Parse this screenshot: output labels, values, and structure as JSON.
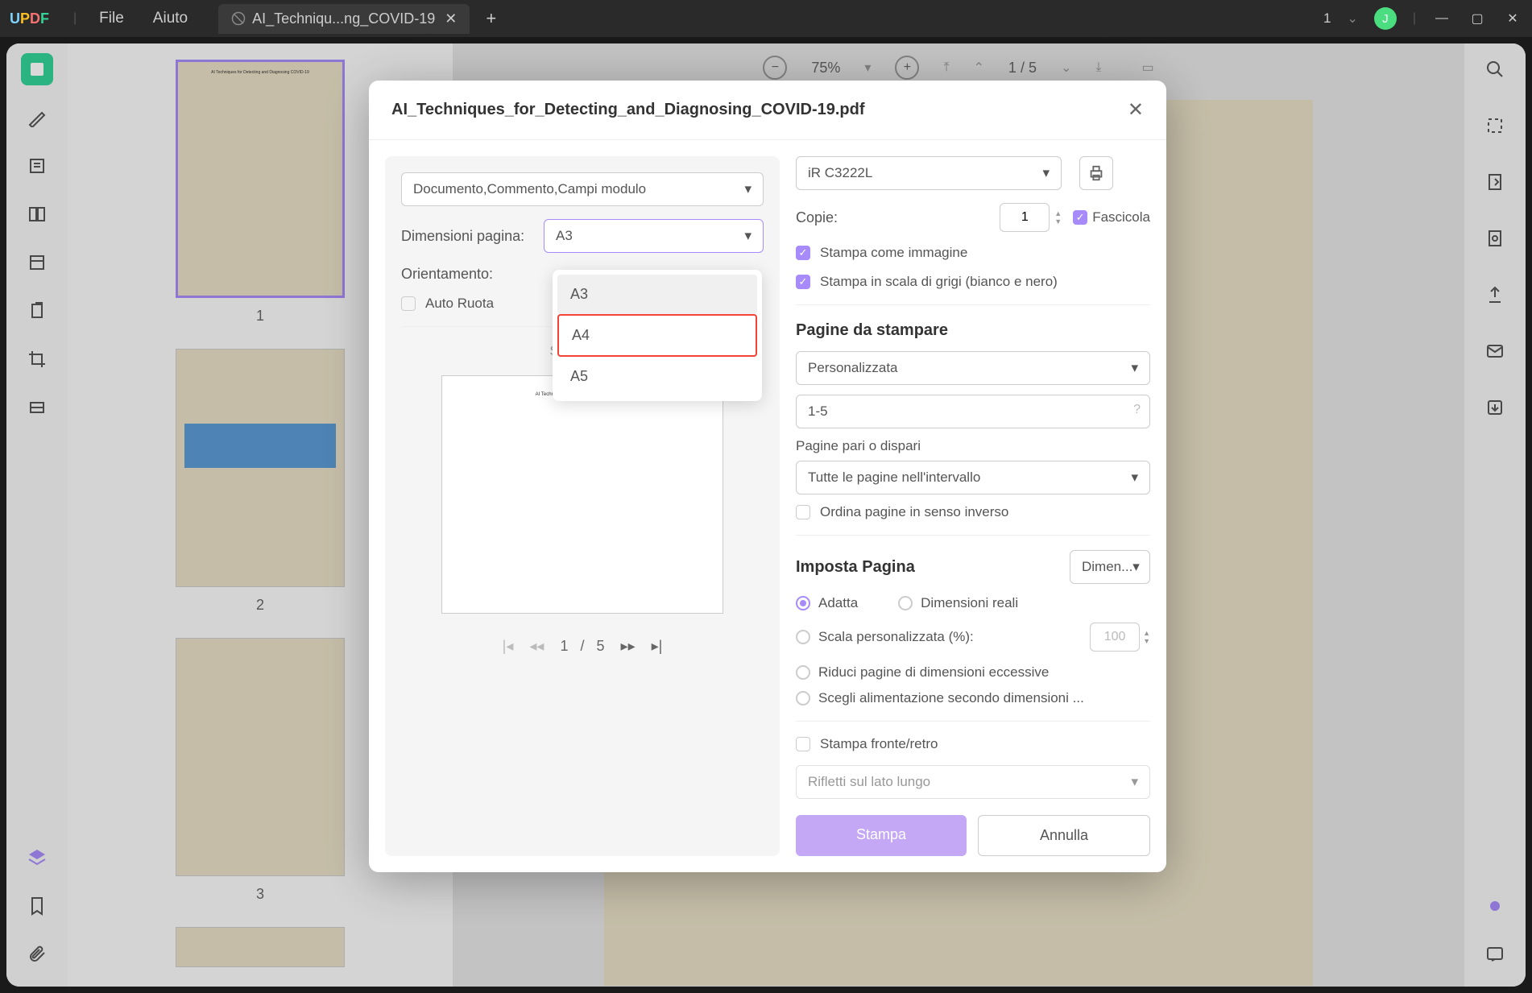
{
  "titlebar": {
    "menu_file": "File",
    "menu_help": "Aiuto",
    "tab_name": "AI_Techniqu...ng_COVID-19",
    "tab_count": "1",
    "avatar_letter": "J"
  },
  "toolbar": {
    "zoom": "75%",
    "page_current": "1",
    "page_sep": "/",
    "page_total": "5"
  },
  "thumbs": {
    "labels": [
      "1",
      "2",
      "3"
    ]
  },
  "dialog": {
    "title": "AI_Techniques_for_Detecting_and_Diagnosing_COVID-19.pdf",
    "preview": {
      "content_select": "Documento,Commento,Campi modulo",
      "page_size_label": "Dimensioni pagina:",
      "page_size_value": "A3",
      "orientation_label": "Orientamento:",
      "auto_rotate": "Auto Ruota",
      "scale_text": "Scala:97%",
      "pager_current": "1",
      "pager_sep": "/",
      "pager_total": "5"
    },
    "settings": {
      "printer": "iR C3222L",
      "copies_label": "Copie:",
      "copies_value": "1",
      "collate": "Fascicola",
      "print_as_image": "Stampa come immagine",
      "print_grayscale": "Stampa in scala di grigi (bianco e nero)",
      "pages_section": "Pagine da stampare",
      "pages_select": "Personalizzata",
      "pages_range": "1-5",
      "odd_even_label": "Pagine pari o dispari",
      "odd_even_value": "Tutte le pagine nell'intervallo",
      "reverse_order": "Ordina pagine in senso inverso",
      "setup_section": "Imposta Pagina",
      "dimen_select": "Dimen...",
      "fit": "Adatta",
      "actual_size": "Dimensioni reali",
      "custom_scale": "Scala personalizzata (%):",
      "custom_scale_value": "100",
      "shrink": "Riduci pagine di dimensioni eccessive",
      "paper_source": "Scegli alimentazione secondo dimensioni ...",
      "duplex": "Stampa fronte/retro",
      "flip_long": "Rifletti sul lato lungo",
      "print_btn": "Stampa",
      "cancel_btn": "Annulla"
    }
  },
  "dropdown": {
    "options": [
      "A3",
      "A4",
      "A5"
    ]
  }
}
